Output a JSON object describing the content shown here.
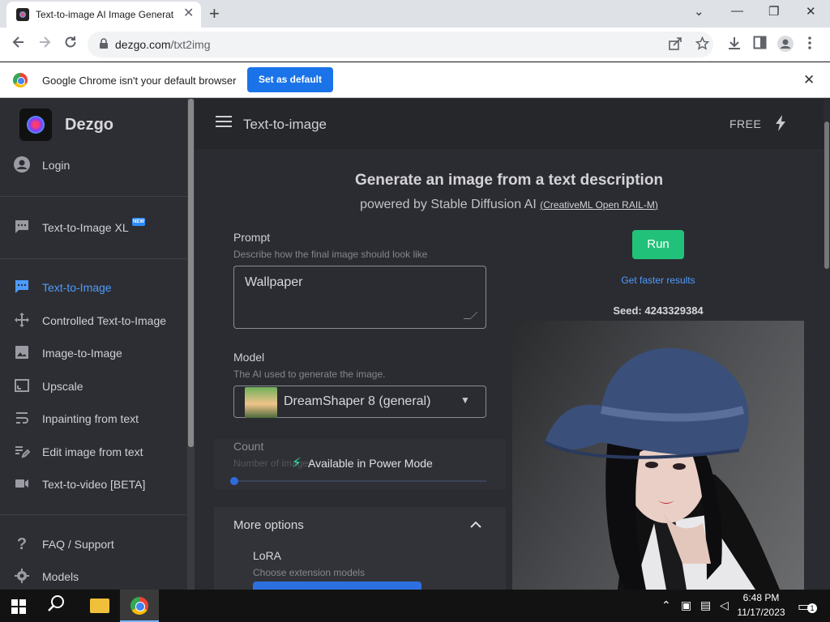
{
  "browser": {
    "tab_title": "Text-to-image AI Image Generat",
    "tab_close": "✕",
    "new_tab": "+",
    "url_host": "dezgo.com",
    "url_path": "/txt2img",
    "window_controls": [
      "⌄",
      "—",
      "❐",
      "✕"
    ],
    "icons": [
      "back-icon",
      "forward-icon",
      "reload-icon",
      "lock-icon",
      "share-icon",
      "star-icon",
      "download-icon",
      "sidepanel-icon",
      "profile-icon",
      "menu-dots-icon"
    ]
  },
  "infobar": {
    "message": "Google Chrome isn't your default browser",
    "button": "Set as default",
    "close": "✕"
  },
  "sidebar": {
    "brand": "Dezgo",
    "login": "Login",
    "xl_label": "Text-to-Image XL",
    "new_badge": "NEW",
    "items": [
      {
        "label": "Text-to-Image",
        "icon": "chat-icon",
        "active": true
      },
      {
        "label": "Controlled Text-to-Image",
        "icon": "move-icon",
        "active": false
      },
      {
        "label": "Image-to-Image",
        "icon": "image-icon",
        "active": false
      },
      {
        "label": "Upscale",
        "icon": "upscale-icon",
        "active": false
      },
      {
        "label": "Inpainting from text",
        "icon": "wrap-text-icon",
        "active": false
      },
      {
        "label": "Edit image from text",
        "icon": "edit-icon",
        "active": false
      },
      {
        "label": "Text-to-video [BETA]",
        "icon": "video-icon",
        "active": false
      }
    ],
    "footer": [
      {
        "label": "FAQ / Support",
        "icon": "help-icon"
      },
      {
        "label": "Models",
        "icon": "models-icon"
      }
    ]
  },
  "appbar": {
    "title": "Text-to-image",
    "plan": "FREE"
  },
  "main": {
    "heading": "Generate an image from a text description",
    "subheading": "powered by Stable Diffusion AI",
    "license_open": "(",
    "license": "CreativeML Open RAIL-M",
    "license_close": ")",
    "prompt_label": "Prompt",
    "prompt_help": "Describe how the final image should look like",
    "prompt_value": "Wallpaper",
    "model_label": "Model",
    "model_help": "The AI used to generate the image.",
    "model_value": "DreamShaper 8 (general)",
    "count_label": "Count",
    "count_help": "Number of images",
    "power_mode": "Available in Power Mode",
    "more_options": "More options",
    "lora_label": "LoRA",
    "lora_help": "Choose extension models",
    "run": "Run",
    "faster": "Get faster results",
    "seed": "Seed: 4243329384"
  },
  "taskbar": {
    "time": "6:48 PM",
    "date": "11/17/2023",
    "notifications": "1"
  }
}
